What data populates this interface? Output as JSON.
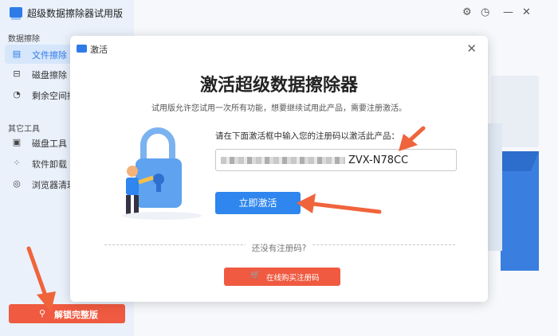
{
  "app": {
    "title": "超级数据擦除器试用版"
  },
  "window_controls": {
    "settings_icon": "gear-icon",
    "history_icon": "clock-icon",
    "minimize": "—",
    "close": "✕"
  },
  "sidebar": {
    "sections": [
      {
        "title": "数据擦除",
        "items": [
          {
            "label": "文件擦除",
            "icon": "file-icon",
            "active": true
          },
          {
            "label": "磁盘擦除",
            "icon": "disk-icon",
            "active": false
          },
          {
            "label": "剩余空间擦",
            "icon": "clock-icon",
            "active": false
          }
        ]
      },
      {
        "title": "其它工具",
        "items": [
          {
            "label": "磁盘工具",
            "icon": "toolbox-icon",
            "active": false
          },
          {
            "label": "软件卸载",
            "icon": "apps-icon",
            "active": false
          },
          {
            "label": "浏览器清理",
            "icon": "browser-icon",
            "active": false
          }
        ]
      }
    ],
    "unlock_label": "解锁完整版"
  },
  "dialog": {
    "title": "激活",
    "close": "✕",
    "heading": "激活超级数据擦除器",
    "subtitle": "试用版允许您试用一次所有功能，想要继续试用此产品，需要注册激活。",
    "prompt": "请在下面激活框中输入您的注册码以激活此产品：",
    "code_value_visible": "ZVX-N78CC",
    "activate_label": "立即激活",
    "no_code_text": "还没有注册码?",
    "buy_label": "在线购买注册码"
  },
  "colors": {
    "accent": "#2e86ee",
    "danger": "#ef5a40",
    "annotation": "#f0643c"
  }
}
